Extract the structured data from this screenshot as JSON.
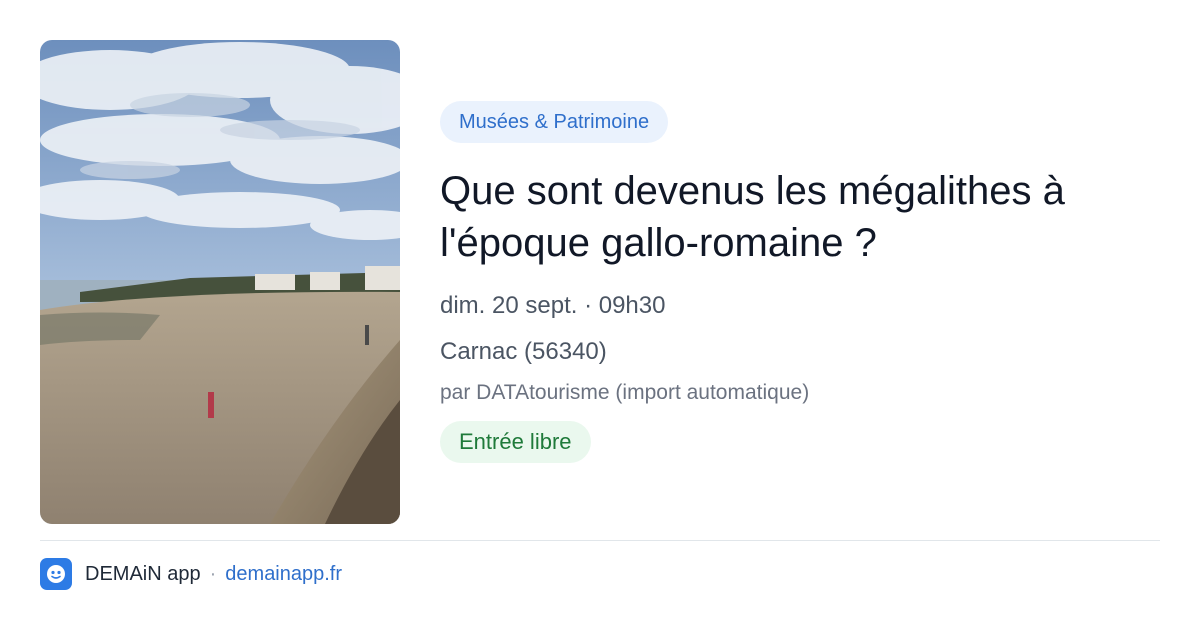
{
  "event": {
    "category": "Musées & Patrimoine",
    "title": "Que sont devenus les mégalithes à l'époque gallo-romaine ?",
    "date": "dim. 20 sept. · 09h30",
    "location": "Carnac (56340)",
    "source": "par DATAtourisme (import automatique)",
    "price": "Entrée libre"
  },
  "footer": {
    "app_name": "DEMAiN app",
    "separator": "·",
    "app_url": "demainapp.fr"
  },
  "colors": {
    "accent_blue": "#2f6fcb",
    "category_bg": "#eaf2fd",
    "price_green": "#1f7a3a",
    "price_bg": "#eaf8ee",
    "app_icon_bg": "#2d7be5"
  },
  "icons": {
    "app": "demain-app-icon"
  }
}
